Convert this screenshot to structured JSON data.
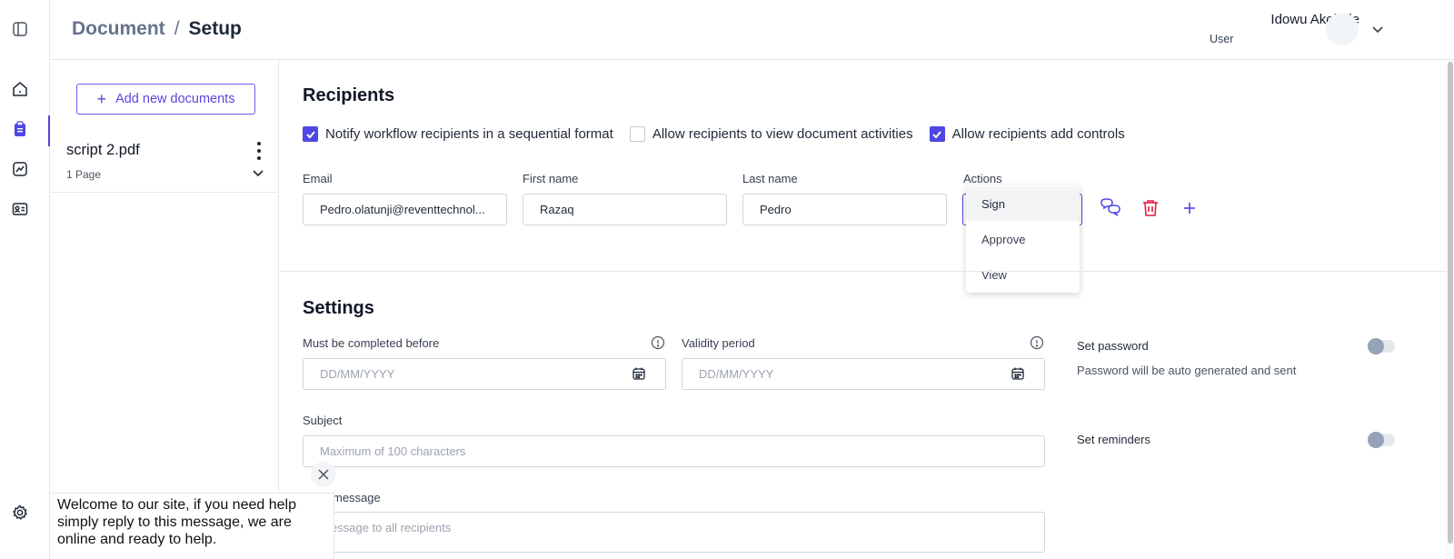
{
  "header": {
    "breadcrumb_parent": "Document",
    "breadcrumb_separator": "/",
    "breadcrumb_current": "Setup",
    "user_name": "Idowu Akolade",
    "user_role": "User"
  },
  "documents": {
    "add_button_label": "Add new documents",
    "items": [
      {
        "name": "script 2.pdf",
        "pages": "1 Page"
      }
    ]
  },
  "recipients": {
    "title": "Recipients",
    "options": [
      {
        "label": "Notify workflow recipients in a sequential format",
        "checked": true
      },
      {
        "label": "Allow recipients to view document activities",
        "checked": false
      },
      {
        "label": "Allow recipients add controls",
        "checked": true
      }
    ],
    "labels": {
      "email": "Email",
      "first_name": "First name",
      "last_name": "Last name",
      "actions": "Actions"
    },
    "row": {
      "email": "Pedro.olatunji@reventtechnol...",
      "first_name": "Razaq",
      "last_name": "Pedro"
    },
    "actions_menu": [
      "Sign",
      "Approve",
      "View"
    ]
  },
  "settings": {
    "title": "Settings",
    "complete_before_label": "Must be completed before",
    "complete_before_placeholder": "DD/MM/YYYY",
    "validity_label": "Validity period",
    "validity_placeholder": "DD/MM/YYYY",
    "subject_label": "Subject",
    "subject_placeholder": "Maximum of 100 characters",
    "message_label": "message",
    "message_placeholder": "essage to all recipients",
    "set_password_label": "Set password",
    "set_password_sub": "Password will be auto generated and sent",
    "set_reminders_label": "Set reminders"
  },
  "chat": {
    "message": "Welcome to our site, if you need help simply reply to this message, we are online and ready to help."
  },
  "colors": {
    "accent": "#4f46e5",
    "danger": "#e11d48"
  }
}
